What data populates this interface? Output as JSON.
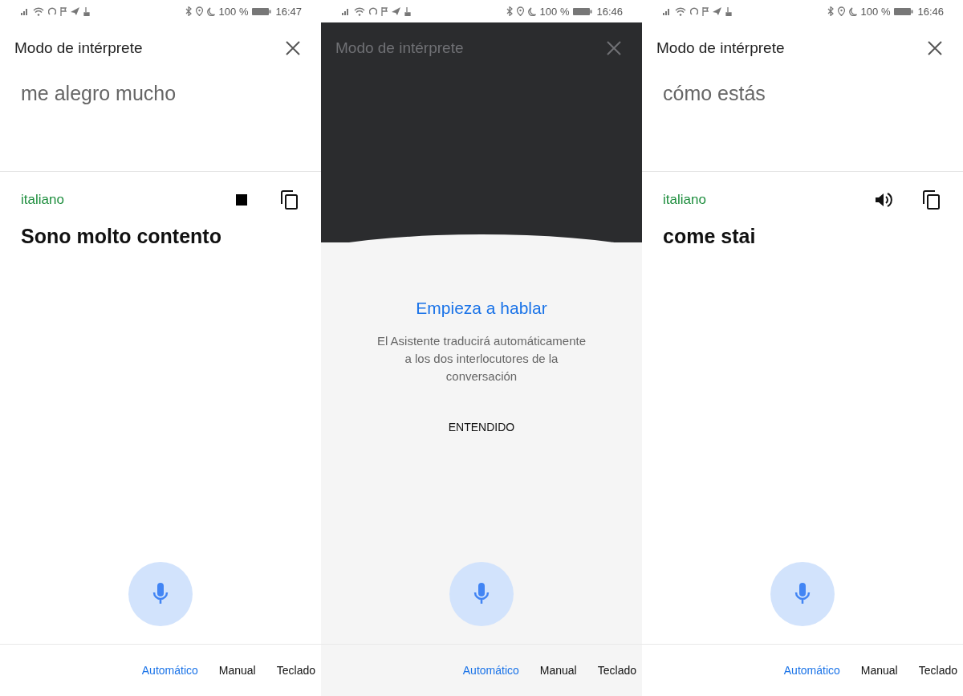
{
  "phones": [
    {
      "kind": "result",
      "status": {
        "battery": "100 %",
        "time": "16:47"
      },
      "title": "Modo de intérprete",
      "source_text": "me alegro mucho",
      "target_language": "italiano",
      "target_text": "Sono molto contento",
      "playing": true,
      "modes": [
        {
          "label": "Automático",
          "selected": true
        },
        {
          "label": "Manual",
          "selected": false
        },
        {
          "label": "Teclado",
          "selected": false
        }
      ]
    },
    {
      "kind": "dialog",
      "status": {
        "battery": "100 %",
        "time": "16:46"
      },
      "title": "Modo de intérprete",
      "dialog": {
        "heading": "Empieza a hablar",
        "body": "El Asistente traducirá automáticamente a los dos interlocutores de la conversación",
        "action": "ENTENDIDO"
      },
      "modes": [
        {
          "label": "Automático",
          "selected": true
        },
        {
          "label": "Manual",
          "selected": false
        },
        {
          "label": "Teclado",
          "selected": false
        }
      ]
    },
    {
      "kind": "result",
      "status": {
        "battery": "100 %",
        "time": "16:46"
      },
      "title": "Modo de intérprete",
      "source_text": "cómo estás",
      "target_language": "italiano",
      "target_text": "come stai",
      "playing": false,
      "modes": [
        {
          "label": "Automático",
          "selected": true
        },
        {
          "label": "Manual",
          "selected": false
        },
        {
          "label": "Teclado",
          "selected": false
        }
      ]
    }
  ]
}
